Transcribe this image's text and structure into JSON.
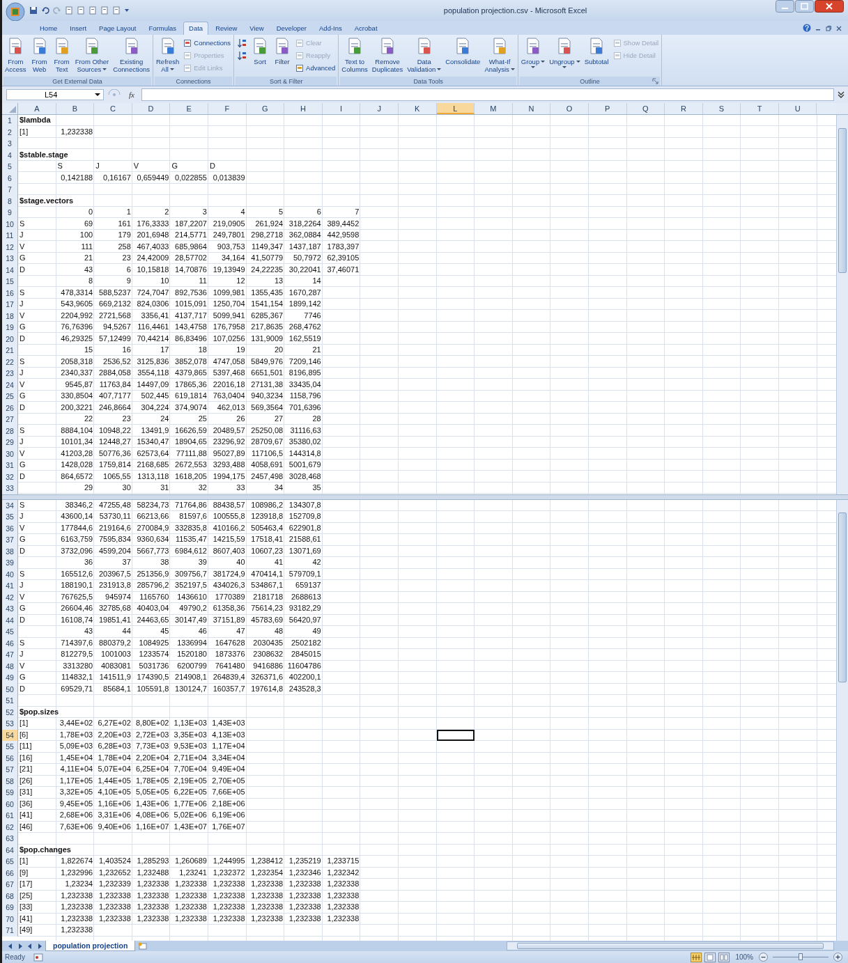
{
  "window": {
    "title": "population projection.csv - Microsoft Excel"
  },
  "tabs": [
    {
      "label": "Home",
      "selected": false
    },
    {
      "label": "Insert",
      "selected": false
    },
    {
      "label": "Page Layout",
      "selected": false
    },
    {
      "label": "Formulas",
      "selected": false
    },
    {
      "label": "Data",
      "selected": true
    },
    {
      "label": "Review",
      "selected": false
    },
    {
      "label": "View",
      "selected": false
    },
    {
      "label": "Developer",
      "selected": false
    },
    {
      "label": "Add-Ins",
      "selected": false
    },
    {
      "label": "Acrobat",
      "selected": false
    }
  ],
  "ribbon": [
    {
      "label": "Get External Data",
      "launcher": false,
      "items": [
        {
          "kind": "large",
          "lines": [
            "From",
            "Access"
          ],
          "dropdown": false
        },
        {
          "kind": "large",
          "lines": [
            "From",
            "Web"
          ],
          "dropdown": false
        },
        {
          "kind": "large",
          "lines": [
            "From",
            "Text"
          ],
          "dropdown": false
        },
        {
          "kind": "large",
          "lines": [
            "From Other",
            "Sources"
          ],
          "dropdown": true
        },
        {
          "kind": "large",
          "lines": [
            "Existing",
            "Connections"
          ],
          "dropdown": false
        }
      ]
    },
    {
      "label": "Connections",
      "launcher": false,
      "items": [
        {
          "kind": "large",
          "lines": [
            "Refresh",
            "All"
          ],
          "dropdown": true
        },
        {
          "kind": "stack",
          "buttons": [
            {
              "kind": "small",
              "label": "Connections",
              "disabled": false
            },
            {
              "kind": "small",
              "label": "Properties",
              "disabled": true
            },
            {
              "kind": "small",
              "label": "Edit Links",
              "disabled": true
            }
          ]
        }
      ]
    },
    {
      "label": "Sort & Filter",
      "launcher": false,
      "items": [
        {
          "kind": "stack",
          "buttons": [
            {
              "kind": "icon",
              "disabled": false
            },
            {
              "kind": "icon",
              "disabled": false
            }
          ]
        },
        {
          "kind": "large",
          "lines": [
            "Sort"
          ],
          "dropdown": false
        },
        {
          "kind": "large",
          "lines": [
            "Filter"
          ],
          "dropdown": false
        },
        {
          "kind": "stack",
          "buttons": [
            {
              "kind": "small",
              "label": "Clear",
              "disabled": true
            },
            {
              "kind": "small",
              "label": "Reapply",
              "disabled": true
            },
            {
              "kind": "small",
              "label": "Advanced",
              "disabled": false
            }
          ]
        }
      ]
    },
    {
      "label": "Data Tools",
      "launcher": false,
      "items": [
        {
          "kind": "large",
          "lines": [
            "Text to",
            "Columns"
          ],
          "dropdown": false
        },
        {
          "kind": "large",
          "lines": [
            "Remove",
            "Duplicates"
          ],
          "dropdown": false
        },
        {
          "kind": "large",
          "lines": [
            "Data",
            "Validation"
          ],
          "dropdown": true
        },
        {
          "kind": "large",
          "lines": [
            "Consolidate"
          ],
          "dropdown": false
        },
        {
          "kind": "large",
          "lines": [
            "What-If",
            "Analysis"
          ],
          "dropdown": true
        }
      ]
    },
    {
      "label": "Outline",
      "launcher": true,
      "items": [
        {
          "kind": "large",
          "lines": [
            "Group"
          ],
          "dropdown": true
        },
        {
          "kind": "large",
          "lines": [
            "Ungroup"
          ],
          "dropdown": true
        },
        {
          "kind": "large",
          "lines": [
            "Subtotal"
          ],
          "dropdown": false
        },
        {
          "kind": "stack",
          "buttons": [
            {
              "kind": "small",
              "label": "Show Detail",
              "disabled": true
            },
            {
              "kind": "small",
              "label": "Hide Detail",
              "disabled": true
            }
          ]
        }
      ]
    }
  ],
  "formula_bar": {
    "name_box": "L54",
    "function_label": "fx"
  },
  "grid": {
    "columns": [
      {
        "label": "A",
        "selected": false
      },
      {
        "label": "B",
        "selected": false
      },
      {
        "label": "C",
        "selected": false
      },
      {
        "label": "D",
        "selected": false
      },
      {
        "label": "E",
        "selected": false
      },
      {
        "label": "F",
        "selected": false
      },
      {
        "label": "G",
        "selected": false
      },
      {
        "label": "H",
        "selected": false
      },
      {
        "label": "I",
        "selected": false
      },
      {
        "label": "J",
        "selected": false
      },
      {
        "label": "K",
        "selected": false
      },
      {
        "label": "L",
        "selected": true
      },
      {
        "label": "M",
        "selected": false
      },
      {
        "label": "N",
        "selected": false
      },
      {
        "label": "O",
        "selected": false
      },
      {
        "label": "P",
        "selected": false
      },
      {
        "label": "Q",
        "selected": false
      },
      {
        "label": "R",
        "selected": false
      },
      {
        "label": "S",
        "selected": false
      },
      {
        "label": "T",
        "selected": false
      },
      {
        "label": "U",
        "selected": false
      }
    ],
    "panes": [
      {
        "rows": [
          {
            "number": "1",
            "kind": "header",
            "selected": false,
            "label": "$lambda"
          },
          {
            "number": "2",
            "kind": "numbers",
            "selected": false,
            "label": "[1]",
            "values": [
              "1,232338"
            ]
          },
          {
            "number": "3",
            "kind": "empty",
            "selected": false
          },
          {
            "number": "4",
            "kind": "header",
            "selected": false,
            "label": "$stable.stage"
          },
          {
            "number": "5",
            "kind": "labels",
            "selected": false,
            "values": [
              "S",
              "J",
              "V",
              "G",
              "D"
            ]
          },
          {
            "number": "6",
            "kind": "numbers",
            "selected": false,
            "values": [
              "0,142188",
              "0,16167",
              "0,659449",
              "0,022855",
              "0,013839"
            ]
          },
          {
            "number": "7",
            "kind": "empty",
            "selected": false
          },
          {
            "number": "8",
            "kind": "header",
            "selected": false,
            "label": "$stage.vectors"
          },
          {
            "number": "9",
            "kind": "numbers",
            "selected": false,
            "values": [
              "0",
              "1",
              "2",
              "3",
              "4",
              "5",
              "6",
              "7"
            ]
          },
          {
            "number": "10",
            "kind": "numbers",
            "selected": false,
            "label": "S",
            "values": [
              "69",
              "161",
              "176,3333",
              "187,2207",
              "219,0905",
              "261,924",
              "318,2264",
              "389,4452"
            ]
          },
          {
            "number": "11",
            "kind": "numbers",
            "selected": false,
            "label": "J",
            "values": [
              "100",
              "179",
              "201,6948",
              "214,5771",
              "249,7801",
              "298,2718",
              "362,0884",
              "442,9598"
            ]
          },
          {
            "number": "12",
            "kind": "numbers",
            "selected": false,
            "label": "V",
            "values": [
              "111",
              "258",
              "467,4033",
              "685,9864",
              "903,753",
              "1149,347",
              "1437,187",
              "1783,397"
            ]
          },
          {
            "number": "13",
            "kind": "numbers",
            "selected": false,
            "label": "G",
            "values": [
              "21",
              "23",
              "24,42009",
              "28,57702",
              "34,164",
              "41,50779",
              "50,7972",
              "62,39105"
            ]
          },
          {
            "number": "14",
            "kind": "numbers",
            "selected": false,
            "label": "D",
            "values": [
              "43",
              "6",
              "10,15818",
              "14,70876",
              "19,13949",
              "24,22235",
              "30,22041",
              "37,46071"
            ]
          },
          {
            "number": "15",
            "kind": "numbers",
            "selected": false,
            "values": [
              "8",
              "9",
              "10",
              "11",
              "12",
              "13",
              "14"
            ]
          },
          {
            "number": "16",
            "kind": "numbers",
            "selected": false,
            "label": "S",
            "values": [
              "478,3314",
              "588,5237",
              "724,7047",
              "892,7536",
              "1099,981",
              "1355,435",
              "1670,287"
            ]
          },
          {
            "number": "17",
            "kind": "numbers",
            "selected": false,
            "label": "J",
            "values": [
              "543,9605",
              "669,2132",
              "824,0306",
              "1015,091",
              "1250,704",
              "1541,154",
              "1899,142"
            ]
          },
          {
            "number": "18",
            "kind": "numbers",
            "selected": false,
            "label": "V",
            "values": [
              "2204,992",
              "2721,568",
              "3356,41",
              "4137,717",
              "5099,941",
              "6285,367",
              "7746"
            ]
          },
          {
            "number": "19",
            "kind": "numbers",
            "selected": false,
            "label": "G",
            "values": [
              "76,76396",
              "94,5267",
              "116,4461",
              "143,4758",
              "176,7958",
              "217,8635",
              "268,4762"
            ]
          },
          {
            "number": "20",
            "kind": "numbers",
            "selected": false,
            "label": "D",
            "values": [
              "46,29325",
              "57,12499",
              "70,44214",
              "86,83496",
              "107,0256",
              "131,9009",
              "162,5519"
            ]
          },
          {
            "number": "21",
            "kind": "numbers",
            "selected": false,
            "values": [
              "15",
              "16",
              "17",
              "18",
              "19",
              "20",
              "21"
            ]
          },
          {
            "number": "22",
            "kind": "numbers",
            "selected": false,
            "label": "S",
            "values": [
              "2058,318",
              "2536,52",
              "3125,836",
              "3852,078",
              "4747,058",
              "5849,976",
              "7209,146"
            ]
          },
          {
            "number": "23",
            "kind": "numbers",
            "selected": false,
            "label": "J",
            "values": [
              "2340,337",
              "2884,058",
              "3554,118",
              "4379,865",
              "5397,468",
              "6651,501",
              "8196,895"
            ]
          },
          {
            "number": "24",
            "kind": "numbers",
            "selected": false,
            "label": "V",
            "values": [
              "9545,87",
              "11763,84",
              "14497,09",
              "17865,36",
              "22016,18",
              "27131,38",
              "33435,04"
            ]
          },
          {
            "number": "25",
            "kind": "numbers",
            "selected": false,
            "label": "G",
            "values": [
              "330,8504",
              "407,7177",
              "502,445",
              "619,1814",
              "763,0404",
              "940,3234",
              "1158,796"
            ]
          },
          {
            "number": "26",
            "kind": "numbers",
            "selected": false,
            "label": "D",
            "values": [
              "200,3221",
              "246,8664",
              "304,224",
              "374,9074",
              "462,013",
              "569,3564",
              "701,6396"
            ]
          },
          {
            "number": "27",
            "kind": "numbers",
            "selected": false,
            "values": [
              "22",
              "23",
              "24",
              "25",
              "26",
              "27",
              "28"
            ]
          },
          {
            "number": "28",
            "kind": "numbers",
            "selected": false,
            "label": "S",
            "values": [
              "8884,104",
              "10948,22",
              "13491,9",
              "16626,59",
              "20489,57",
              "25250,08",
              "31116,63"
            ]
          },
          {
            "number": "29",
            "kind": "numbers",
            "selected": false,
            "label": "J",
            "values": [
              "10101,34",
              "12448,27",
              "15340,47",
              "18904,65",
              "23296,92",
              "28709,67",
              "35380,02"
            ]
          },
          {
            "number": "30",
            "kind": "numbers",
            "selected": false,
            "label": "V",
            "values": [
              "41203,28",
              "50776,36",
              "62573,64",
              "77111,88",
              "95027,89",
              "117106,5",
              "144314,8"
            ]
          },
          {
            "number": "31",
            "kind": "numbers",
            "selected": false,
            "label": "G",
            "values": [
              "1428,028",
              "1759,814",
              "2168,685",
              "2672,553",
              "3293,488",
              "4058,691",
              "5001,679"
            ]
          },
          {
            "number": "32",
            "kind": "numbers",
            "selected": false,
            "label": "D",
            "values": [
              "864,6572",
              "1065,55",
              "1313,118",
              "1618,205",
              "1994,175",
              "2457,498",
              "3028,468"
            ]
          },
          {
            "number": "33",
            "kind": "numbers",
            "selected": false,
            "values": [
              "29",
              "30",
              "31",
              "32",
              "33",
              "34",
              "35"
            ]
          }
        ]
      },
      {
        "rows": [
          {
            "number": "34",
            "kind": "numbers",
            "selected": false,
            "label": "S",
            "values": [
              "38346,2",
              "47255,48",
              "58234,73",
              "71764,86",
              "88438,57",
              "108986,2",
              "134307,8"
            ]
          },
          {
            "number": "35",
            "kind": "numbers",
            "selected": false,
            "label": "J",
            "values": [
              "43600,14",
              "53730,11",
              "66213,66",
              "81597,6",
              "100555,8",
              "123918,8",
              "152709,8"
            ]
          },
          {
            "number": "36",
            "kind": "numbers",
            "selected": false,
            "label": "V",
            "values": [
              "177844,6",
              "219164,6",
              "270084,9",
              "332835,8",
              "410166,2",
              "505463,4",
              "622901,8"
            ]
          },
          {
            "number": "37",
            "kind": "numbers",
            "selected": false,
            "label": "G",
            "values": [
              "6163,759",
              "7595,834",
              "9360,634",
              "11535,47",
              "14215,59",
              "17518,41",
              "21588,61"
            ]
          },
          {
            "number": "38",
            "kind": "numbers",
            "selected": false,
            "label": "D",
            "values": [
              "3732,096",
              "4599,204",
              "5667,773",
              "6984,612",
              "8607,403",
              "10607,23",
              "13071,69"
            ]
          },
          {
            "number": "39",
            "kind": "numbers",
            "selected": false,
            "values": [
              "36",
              "37",
              "38",
              "39",
              "40",
              "41",
              "42"
            ]
          },
          {
            "number": "40",
            "kind": "numbers",
            "selected": false,
            "label": "S",
            "values": [
              "165512,6",
              "203967,5",
              "251356,9",
              "309756,7",
              "381724,9",
              "470414,1",
              "579709,1"
            ]
          },
          {
            "number": "41",
            "kind": "numbers",
            "selected": false,
            "label": "J",
            "values": [
              "188190,1",
              "231913,8",
              "285796,2",
              "352197,5",
              "434026,3",
              "534867,1",
              "659137"
            ]
          },
          {
            "number": "42",
            "kind": "numbers",
            "selected": false,
            "label": "V",
            "values": [
              "767625,5",
              "945974",
              "1165760",
              "1436610",
              "1770389",
              "2181718",
              "2688613"
            ]
          },
          {
            "number": "43",
            "kind": "numbers",
            "selected": false,
            "label": "G",
            "values": [
              "26604,46",
              "32785,68",
              "40403,04",
              "49790,2",
              "61358,36",
              "75614,23",
              "93182,29"
            ]
          },
          {
            "number": "44",
            "kind": "numbers",
            "selected": false,
            "label": "D",
            "values": [
              "16108,74",
              "19851,41",
              "24463,65",
              "30147,49",
              "37151,89",
              "45783,69",
              "56420,97"
            ]
          },
          {
            "number": "45",
            "kind": "numbers",
            "selected": false,
            "values": [
              "43",
              "44",
              "45",
              "46",
              "47",
              "48",
              "49"
            ]
          },
          {
            "number": "46",
            "kind": "numbers",
            "selected": false,
            "label": "S",
            "values": [
              "714397,6",
              "880379,2",
              "1084925",
              "1336994",
              "1647628",
              "2030435",
              "2502182"
            ]
          },
          {
            "number": "47",
            "kind": "numbers",
            "selected": false,
            "label": "J",
            "values": [
              "812279,5",
              "1001003",
              "1233574",
              "1520180",
              "1873376",
              "2308632",
              "2845015"
            ]
          },
          {
            "number": "48",
            "kind": "numbers",
            "selected": false,
            "label": "V",
            "values": [
              "3313280",
              "4083081",
              "5031736",
              "6200799",
              "7641480",
              "9416886",
              "11604786"
            ]
          },
          {
            "number": "49",
            "kind": "numbers",
            "selected": false,
            "label": "G",
            "values": [
              "114832,1",
              "141511,9",
              "174390,5",
              "214908,1",
              "264839,4",
              "326371,6",
              "402200,1"
            ]
          },
          {
            "number": "50",
            "kind": "numbers",
            "selected": false,
            "label": "D",
            "values": [
              "69529,71",
              "85684,1",
              "105591,8",
              "130124,7",
              "160357,7",
              "197614,8",
              "243528,3"
            ]
          },
          {
            "number": "51",
            "kind": "empty",
            "selected": false
          },
          {
            "number": "52",
            "kind": "header",
            "selected": false,
            "label": "$pop.sizes"
          },
          {
            "number": "53",
            "kind": "numbers",
            "selected": false,
            "label": "[1]",
            "values": [
              "3,44E+02",
              "6,27E+02",
              "8,80E+02",
              "1,13E+03",
              "1,43E+03"
            ]
          },
          {
            "number": "54",
            "kind": "numbers",
            "selected": true,
            "label": "[6]",
            "values": [
              "1,78E+03",
              "2,20E+03",
              "2,72E+03",
              "3,35E+03",
              "4,13E+03"
            ]
          },
          {
            "number": "55",
            "kind": "numbers",
            "selected": false,
            "label": "[11]",
            "values": [
              "5,09E+03",
              "6,28E+03",
              "7,73E+03",
              "9,53E+03",
              "1,17E+04"
            ]
          },
          {
            "number": "56",
            "kind": "numbers",
            "selected": false,
            "label": "[16]",
            "values": [
              "1,45E+04",
              "1,78E+04",
              "2,20E+04",
              "2,71E+04",
              "3,34E+04"
            ]
          },
          {
            "number": "57",
            "kind": "numbers",
            "selected": false,
            "label": "[21]",
            "values": [
              "4,11E+04",
              "5,07E+04",
              "6,25E+04",
              "7,70E+04",
              "9,49E+04"
            ]
          },
          {
            "number": "58",
            "kind": "numbers",
            "selected": false,
            "label": "[26]",
            "values": [
              "1,17E+05",
              "1,44E+05",
              "1,78E+05",
              "2,19E+05",
              "2,70E+05"
            ]
          },
          {
            "number": "59",
            "kind": "numbers",
            "selected": false,
            "label": "[31]",
            "values": [
              "3,32E+05",
              "4,10E+05",
              "5,05E+05",
              "6,22E+05",
              "7,66E+05"
            ]
          },
          {
            "number": "60",
            "kind": "numbers",
            "selected": false,
            "label": "[36]",
            "values": [
              "9,45E+05",
              "1,16E+06",
              "1,43E+06",
              "1,77E+06",
              "2,18E+06"
            ]
          },
          {
            "number": "61",
            "kind": "numbers",
            "selected": false,
            "label": "[41]",
            "values": [
              "2,68E+06",
              "3,31E+06",
              "4,08E+06",
              "5,02E+06",
              "6,19E+06"
            ]
          },
          {
            "number": "62",
            "kind": "numbers",
            "selected": false,
            "label": "[46]",
            "values": [
              "7,63E+06",
              "9,40E+06",
              "1,16E+07",
              "1,43E+07",
              "1,76E+07"
            ]
          },
          {
            "number": "63",
            "kind": "empty",
            "selected": false
          },
          {
            "number": "64",
            "kind": "header",
            "selected": false,
            "label": "$pop.changes"
          },
          {
            "number": "65",
            "kind": "numbers",
            "selected": false,
            "label": "[1]",
            "values": [
              "1,822674",
              "1,403524",
              "1,285293",
              "1,260689",
              "1,244995",
              "1,238412",
              "1,235219",
              "1,233715"
            ]
          },
          {
            "number": "66",
            "kind": "numbers",
            "selected": false,
            "label": "[9]",
            "values": [
              "1,232996",
              "1,232652",
              "1,232488",
              "1,23241",
              "1,232372",
              "1,232354",
              "1,232346",
              "1,232342"
            ]
          },
          {
            "number": "67",
            "kind": "numbers",
            "selected": false,
            "label": "[17]",
            "values": [
              "1,23234",
              "1,232339",
              "1,232338",
              "1,232338",
              "1,232338",
              "1,232338",
              "1,232338",
              "1,232338"
            ]
          },
          {
            "number": "68",
            "kind": "numbers",
            "selected": false,
            "label": "[25]",
            "values": [
              "1,232338",
              "1,232338",
              "1,232338",
              "1,232338",
              "1,232338",
              "1,232338",
              "1,232338",
              "1,232338"
            ]
          },
          {
            "number": "69",
            "kind": "numbers",
            "selected": false,
            "label": "[33]",
            "values": [
              "1,232338",
              "1,232338",
              "1,232338",
              "1,232338",
              "1,232338",
              "1,232338",
              "1,232338",
              "1,232338"
            ]
          },
          {
            "number": "70",
            "kind": "numbers",
            "selected": false,
            "label": "[41]",
            "values": [
              "1,232338",
              "1,232338",
              "1,232338",
              "1,232338",
              "1,232338",
              "1,232338",
              "1,232338",
              "1,232338"
            ]
          },
          {
            "number": "71",
            "kind": "numbers",
            "selected": false,
            "label": "[49]",
            "values": [
              "1,232338"
            ]
          }
        ]
      }
    ]
  },
  "sheet_tabs": [
    {
      "label": "population projection",
      "selected": true
    }
  ],
  "status_bar": {
    "status": "Ready",
    "zoom": {
      "reading": "100%",
      "level": 0.5
    }
  }
}
